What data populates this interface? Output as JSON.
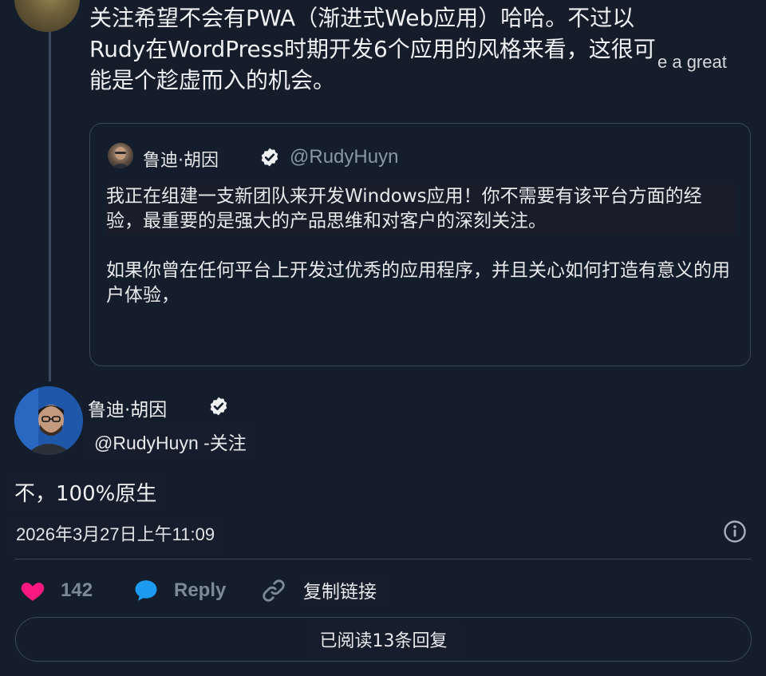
{
  "parent_tweet": {
    "text": "关注希望不会有PWA（渐进式Web应用）哈哈。不过以Rudy在WordPress时期开发6个应用的风格来看，这很可能是个趁虚而入的机会。",
    "peek_text": "e a great"
  },
  "quoted_tweet": {
    "name": "鲁迪·胡因",
    "handle": "@RudyHuyn",
    "paragraph1": "我正在组建一支新团队来开发Windows应用！你不需要有该平台方面的经验，最重要的是强大的产品思维和对客户的深刻关注。",
    "paragraph2": "如果你曾在任何平台上开发过优秀的应用程序，并且关心如何打造有意义的用户体验，"
  },
  "main_tweet": {
    "name": "鲁迪·胡因",
    "handle_follow": "@RudyHuyn -关注",
    "text": "不，100%原生",
    "timestamp": "2026年3月27日上午11:09"
  },
  "actions": {
    "likes": "142",
    "reply_label": "Reply",
    "copy_link_label": "复制链接"
  },
  "read_replies_label": "已阅读13条回复",
  "colors": {
    "background": "#141d2b",
    "like": "#f91880",
    "reply": "#1d9bf0",
    "muted": "#7d8996"
  },
  "icons": [
    "heart-icon",
    "speech-bubble-icon",
    "link-icon",
    "info-icon",
    "verified-badge-icon"
  ]
}
